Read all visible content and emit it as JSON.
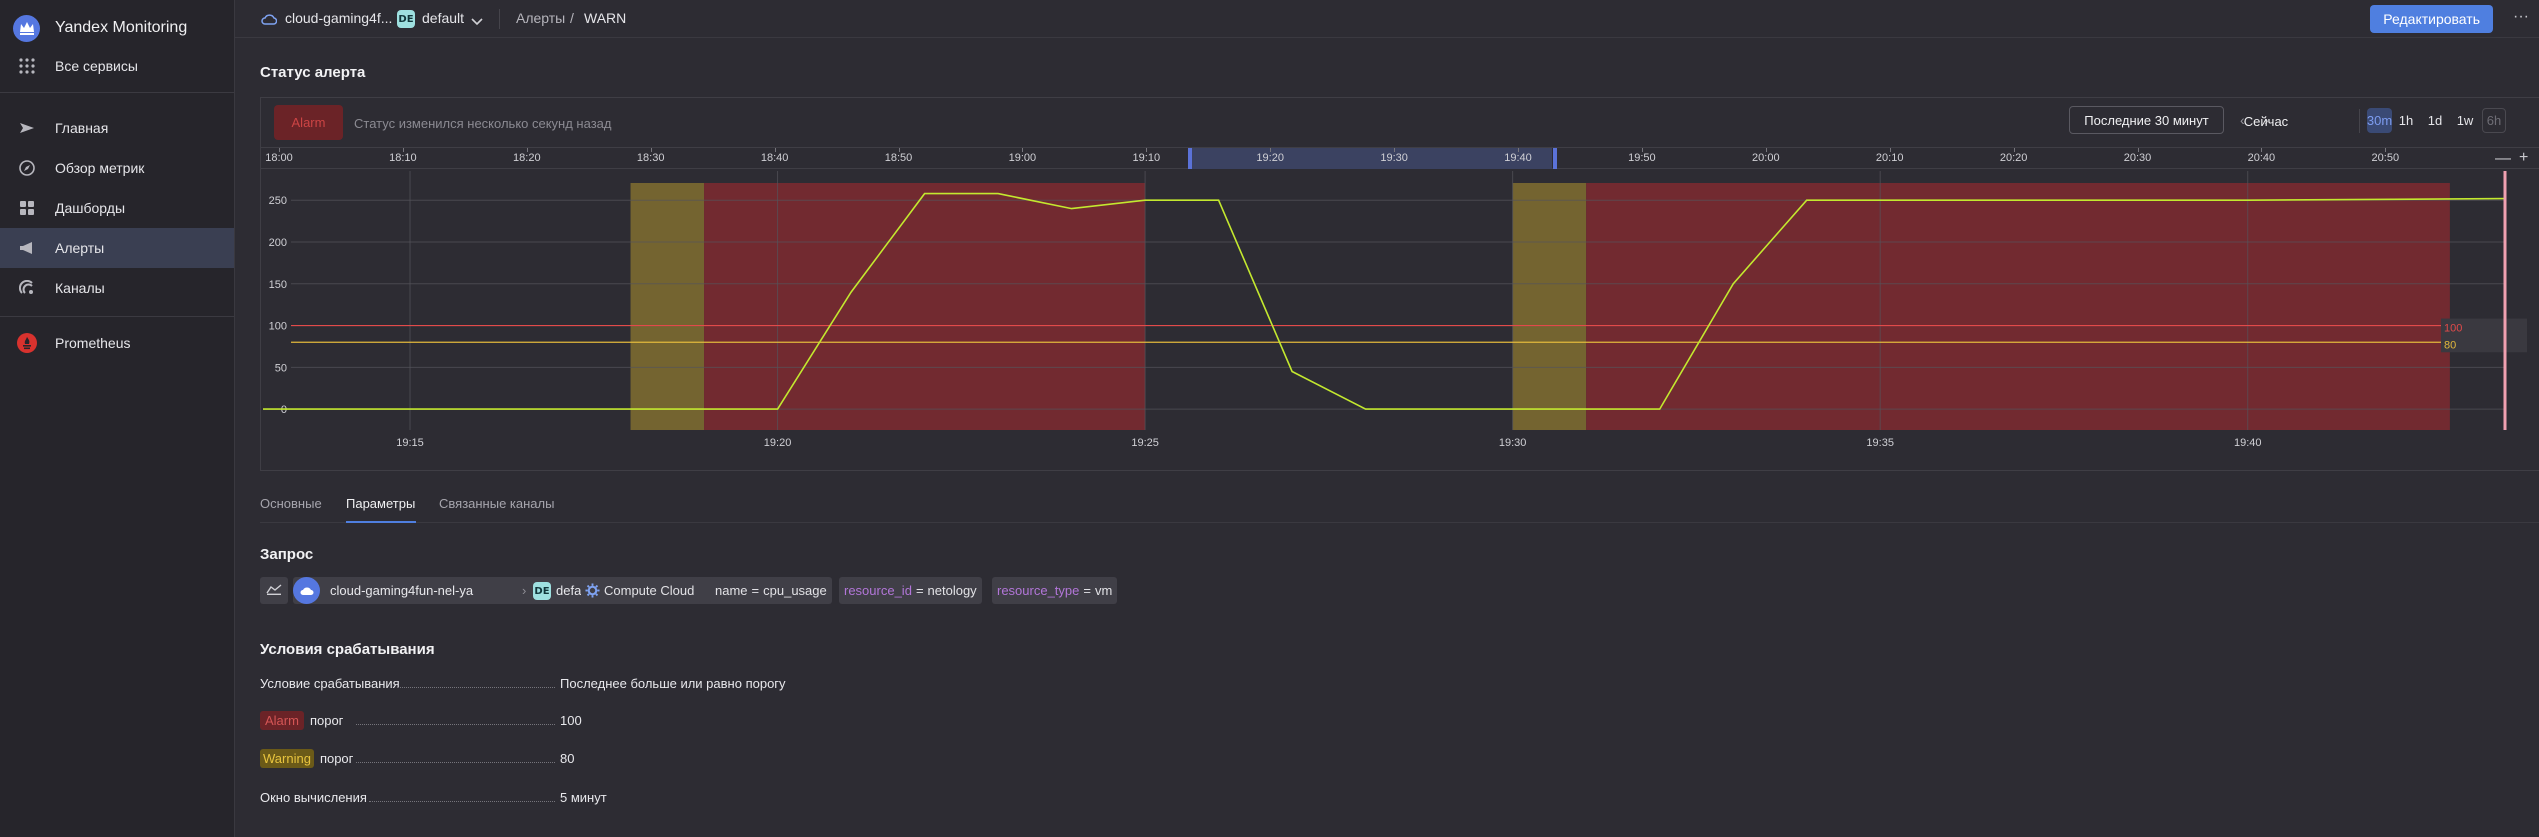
{
  "sidebar": {
    "brand": "Yandex Monitoring",
    "all_services": "Все сервисы",
    "items": [
      {
        "label": "Главная"
      },
      {
        "label": "Обзор метрик"
      },
      {
        "label": "Дашборды"
      },
      {
        "label": "Алерты"
      },
      {
        "label": "Каналы"
      }
    ],
    "prometheus": "Prometheus"
  },
  "topbar": {
    "cloud": "cloud-gaming4f...",
    "folder_badge": "DE",
    "folder": "default",
    "breadcrumb_parent": "Алерты",
    "breadcrumb_separator": "/",
    "breadcrumb_current": "WARN",
    "edit_label": "Редактировать",
    "more_label": "···"
  },
  "status": {
    "heading": "Статус алерта",
    "pill": "Alarm",
    "text": "Статус изменился несколько секунд назад"
  },
  "time_controls": {
    "range_label": "Последние 30 минут",
    "prev": "‹",
    "next": "›",
    "now_label": "Сейчас",
    "ranges": [
      "30m",
      "1h",
      "1d",
      "1w",
      "6h"
    ],
    "active_range": "30m",
    "zoom_out": "—",
    "zoom_in": "+"
  },
  "timeline": {
    "labels": [
      "18:00",
      "18:10",
      "18:20",
      "18:30",
      "18:40",
      "18:50",
      "19:00",
      "19:10",
      "19:20",
      "19:30",
      "19:40",
      "19:50",
      "20:00",
      "20:10",
      "20:20",
      "20:30",
      "20:40",
      "20:50"
    ]
  },
  "colors": {
    "series": "#c3e82f",
    "alarm_band": "#7a2a30",
    "warning_band": "#7c6a30",
    "alarm_line": "#e24a4a",
    "warn_line": "#e2b83c",
    "accent": "#4f7fe0"
  },
  "chart_data": {
    "type": "line",
    "x_unit": "time (HH:MM)",
    "x_range": [
      "19:13",
      "19:43:30"
    ],
    "ylim": [
      -25,
      285
    ],
    "yticks": [
      0,
      50,
      100,
      150,
      200,
      250
    ],
    "xticks": [
      "19:15",
      "19:20",
      "19:25",
      "19:30",
      "19:35",
      "19:40"
    ],
    "series": [
      {
        "x": [
          "19:13:00",
          "19:15:00",
          "19:20:00",
          "19:21:00",
          "19:22:00",
          "19:23:00",
          "19:24:00",
          "19:25:00",
          "19:26:00",
          "19:27:00",
          "19:28:00",
          "19:29:00",
          "19:30:00",
          "19:31:00",
          "19:32:00",
          "19:33:00",
          "19:34:00",
          "19:35:00",
          "19:40:00",
          "19:43:30"
        ],
        "values": [
          0,
          0,
          0,
          140,
          258,
          258,
          240,
          250,
          250,
          45,
          0,
          0,
          0,
          0,
          0,
          150,
          250,
          250,
          250,
          252
        ]
      }
    ],
    "thresholds": [
      {
        "label": "100",
        "value": 100,
        "level": "alarm"
      },
      {
        "label": "80",
        "value": 80,
        "level": "warning"
      }
    ],
    "status_bands": [
      {
        "from": "19:18",
        "to": "19:19",
        "status": "warning"
      },
      {
        "from": "19:19",
        "to": "19:25",
        "status": "alarm"
      },
      {
        "from": "19:30",
        "to": "19:31",
        "status": "warning"
      },
      {
        "from": "19:31",
        "to": "19:42:45",
        "status": "alarm"
      }
    ],
    "current_time": "19:43:30",
    "grid": true
  },
  "tabs": [
    {
      "label": "Основные"
    },
    {
      "label": "Параметры"
    },
    {
      "label": "Связанные каналы"
    }
  ],
  "active_tab": "Параметры",
  "query": {
    "heading": "Запрос",
    "cloud": "cloud-gaming4fun-nel-ya",
    "chevron": "›",
    "folder_badge": "DE",
    "folder": "default",
    "service": "Compute Cloud",
    "filters": [
      {
        "key": "name",
        "op": "=",
        "value": "cpu_usage"
      },
      {
        "key": "resource_id",
        "op": "=",
        "value": "netology"
      },
      {
        "key": "resource_type",
        "op": "=",
        "value": "vm"
      }
    ]
  },
  "conditions": {
    "heading": "Условия срабатывания",
    "rows": [
      {
        "label": "Условие срабатывания",
        "value": "Последнее больше или равно порогу"
      },
      {
        "tag": "Alarm",
        "label": "порог",
        "value": "100"
      },
      {
        "tag": "Warning",
        "label": "порог",
        "value": "80"
      },
      {
        "label": "Окно вычисления",
        "value": "5 минут"
      }
    ]
  }
}
